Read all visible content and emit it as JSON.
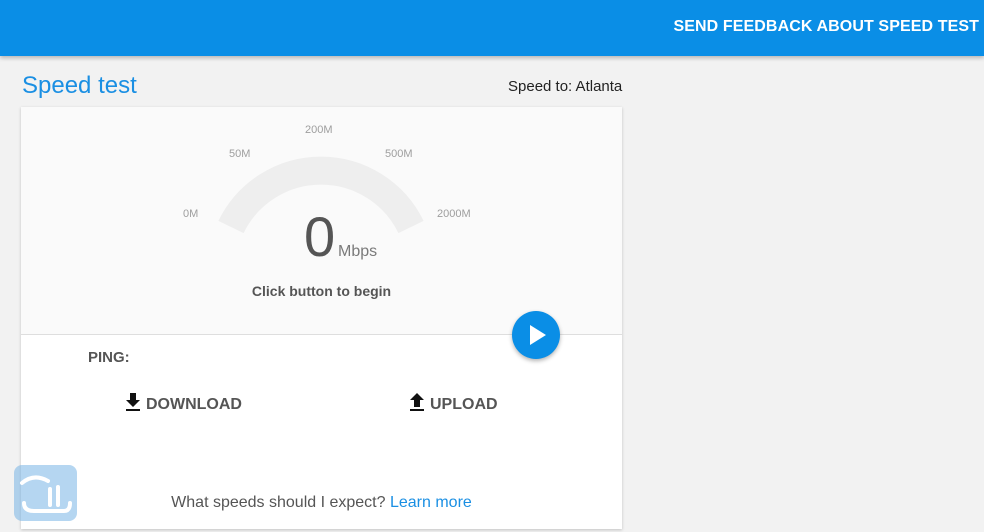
{
  "header": {
    "feedback_label": "SEND FEEDBACK ABOUT SPEED TEST"
  },
  "page": {
    "title": "Speed test",
    "speed_to": "Speed to: Atlanta"
  },
  "gauge": {
    "ticks": [
      "0M",
      "50M",
      "200M",
      "500M",
      "2000M"
    ],
    "value": "0",
    "unit": "Mbps",
    "hint": "Click button to begin"
  },
  "results": {
    "ping_label": "PING:",
    "download_label": "DOWNLOAD",
    "upload_label": "UPLOAD"
  },
  "footer": {
    "question": "What speeds should I expect?",
    "learn_more": "Learn more"
  },
  "colors": {
    "accent": "#0a8ee6",
    "title_blue": "#1a8fe3",
    "gauge_track": "#eeeeee"
  },
  "icons": {
    "play": "play-icon",
    "download": "download-arrow-icon",
    "upload": "upload-arrow-icon"
  }
}
